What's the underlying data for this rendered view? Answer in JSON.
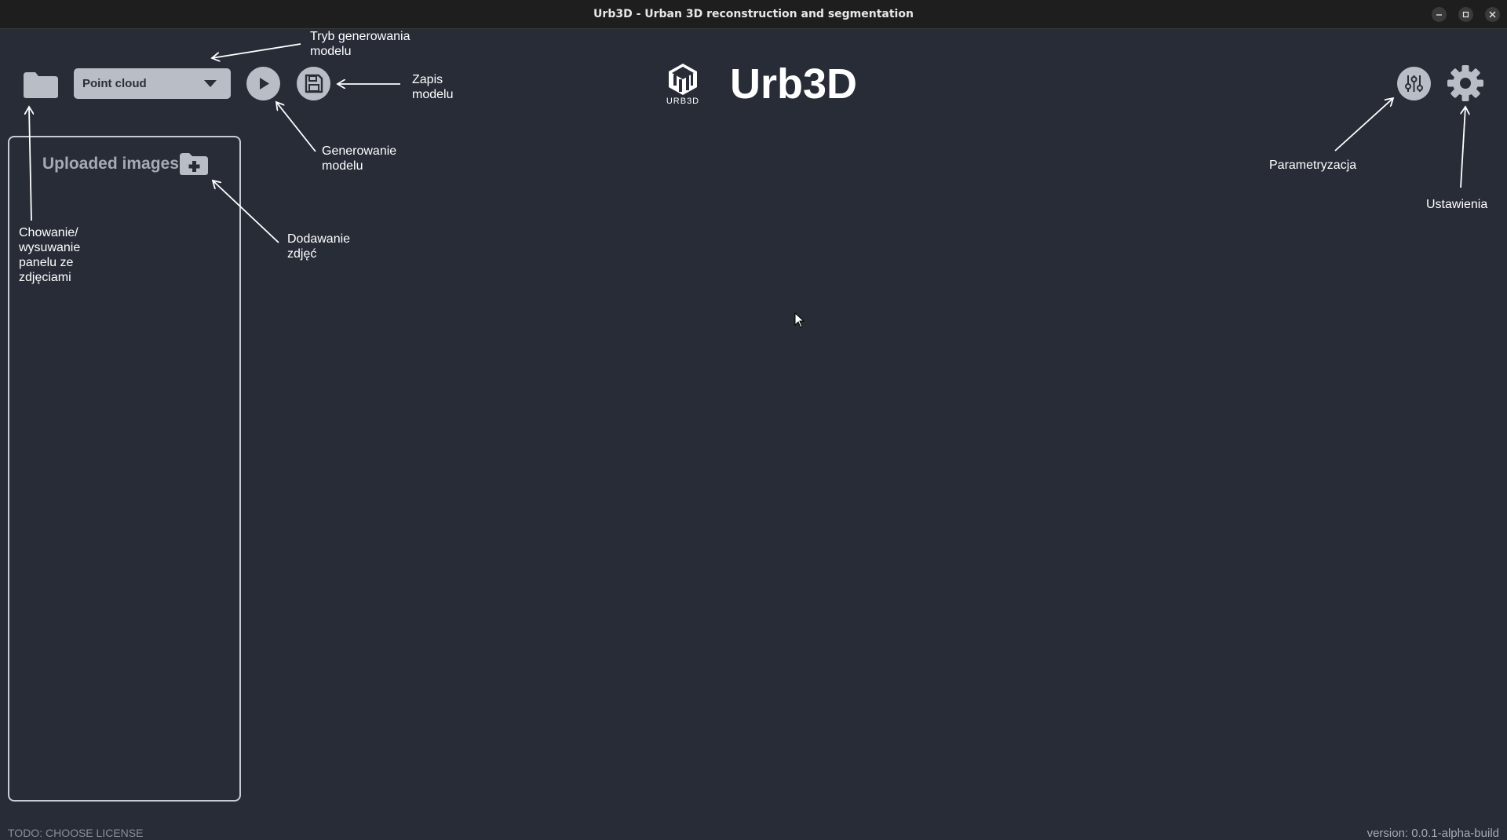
{
  "window": {
    "title": "Urb3D - Urban 3D reconstruction and segmentation",
    "controls": [
      "minimize-icon",
      "maximize-icon",
      "close-icon"
    ]
  },
  "toolbar": {
    "mode_select": {
      "selected": "Point cloud"
    },
    "icons": [
      "folder-icon",
      "play-icon",
      "floppy-disk-icon"
    ]
  },
  "brand": {
    "logo_text": "URB3D",
    "title": "Urb3D"
  },
  "right_toolbar": {
    "icons": [
      "sliders-icon",
      "gear-icon"
    ]
  },
  "images_panel": {
    "title": "Uploaded images",
    "add_icon": "folder-plus-icon"
  },
  "annotations": {
    "mode": "Tryb generowania\nmodelu",
    "save": "Zapis\nmodelu",
    "generate": "Generowanie\nmodelu",
    "add_images": "Dodawanie\nzdjęć",
    "toggle_panel": "Chowanie/\nwysuwanie\npanelu ze\nzdjęciami",
    "params": "Parametryzacja",
    "settings": "Ustawienia"
  },
  "footer": {
    "license": "TODO: CHOOSE LICENSE",
    "version": "version: 0.0.1-alpha-build"
  },
  "colors": {
    "background": "#282c37",
    "control_fill": "#b9bdc6",
    "panel_border": "#c7cbd4",
    "titlebar": "#1e1e1e"
  }
}
